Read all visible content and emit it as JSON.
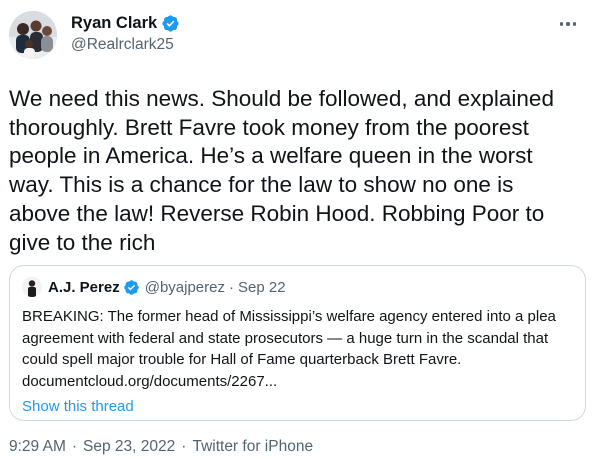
{
  "author": {
    "display_name": "Ryan Clark",
    "handle": "@Realrclark25",
    "verified": true
  },
  "tweet": {
    "text": "We need this news. Should be followed, and explained\nthoroughly. Brett Favre took money from the poorest\npeople in America. He’s a welfare queen in the worst\nway. This is a chance for the law to show no one is\nabove the law! Reverse Robin Hood. Robbing Poor to\ngive to the rich"
  },
  "quoted_tweet": {
    "display_name": "A.J. Perez",
    "handle": "@byajperez",
    "separator": "·",
    "date": "Sep 22",
    "text": "BREAKING: The former head of Mississippi’s welfare agency entered into a plea\nagreement with federal and state prosecutors — a huge turn in the scandal that\ncould spell major trouble for Hall of Fame quarterback Brett Favre.\ndocumentcloud.org/documents/2267...",
    "show_thread_label": "Show this thread"
  },
  "meta": {
    "time": "9:29 AM",
    "separator": "·",
    "date": "Sep 23, 2022",
    "source": "Twitter for iPhone"
  },
  "icons": {
    "verified": "verified-badge-icon",
    "more": "more-horizontal-icon"
  },
  "colors": {
    "accent": "#1d9bf0",
    "text": "#0f1419",
    "secondary": "#536471",
    "border": "#cfd9de"
  }
}
